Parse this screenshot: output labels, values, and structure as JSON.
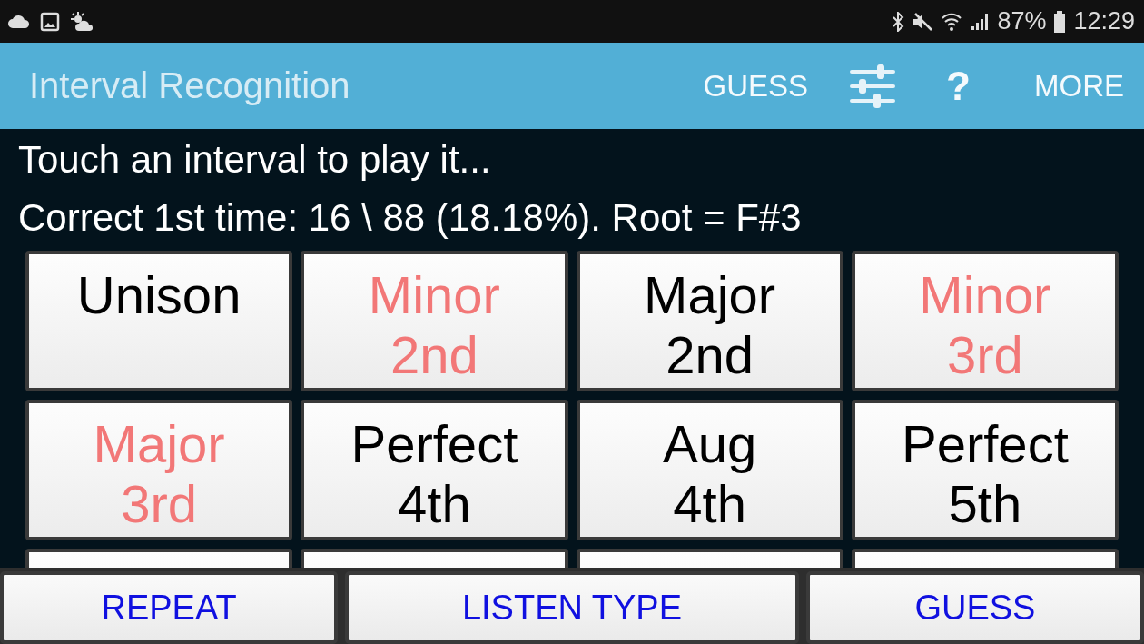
{
  "status_bar": {
    "battery": "87%",
    "time": "12:29"
  },
  "app_bar": {
    "title": "Interval Recognition",
    "actions": [
      {
        "kind": "text",
        "label": "GUESS"
      },
      {
        "kind": "sliders"
      },
      {
        "kind": "help",
        "label": "?"
      },
      {
        "kind": "text",
        "label": "MORE"
      }
    ]
  },
  "instruction": "Touch an interval to play it...",
  "score": "Correct 1st time: 16 \\ 88 (18.18%).  Root = F#3",
  "intervals": [
    {
      "lines": [
        "Unison"
      ],
      "missed": false
    },
    {
      "lines": [
        "Minor",
        "2nd"
      ],
      "missed": true
    },
    {
      "lines": [
        "Major",
        "2nd"
      ],
      "missed": false
    },
    {
      "lines": [
        "Minor",
        "3rd"
      ],
      "missed": true
    },
    {
      "lines": [
        "Major",
        "3rd"
      ],
      "missed": true
    },
    {
      "lines": [
        "Perfect",
        "4th"
      ],
      "missed": false
    },
    {
      "lines": [
        "Aug",
        "4th"
      ],
      "missed": false
    },
    {
      "lines": [
        "Perfect",
        "5th"
      ],
      "missed": false
    }
  ],
  "bottom_buttons": [
    "REPEAT",
    "LISTEN TYPE",
    "GUESS"
  ]
}
